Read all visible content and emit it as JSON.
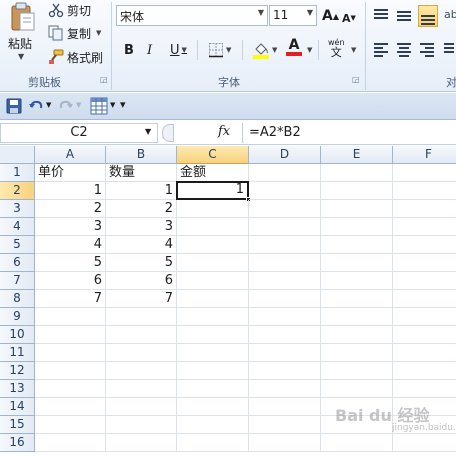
{
  "ribbon": {
    "clipboard": {
      "paste": "粘贴",
      "cut": "剪切",
      "copy": "复制",
      "format_painter": "格式刷",
      "group_label": "剪贴板"
    },
    "font": {
      "font_name": "宋体",
      "font_size": "11",
      "group_label": "字体",
      "bold": "B",
      "italic": "I",
      "underline": "U",
      "grow": "A",
      "shrink": "A",
      "phonetic": "wén",
      "font_color_letter": "A",
      "font_color": "#e02020",
      "fill_color": "#ffff00"
    },
    "alignment": {
      "group_label_partial": "对"
    }
  },
  "formula_bar": {
    "name_box": "C2",
    "fx": "fx",
    "formula": "=A2*B2"
  },
  "grid": {
    "columns": [
      "A",
      "B",
      "C",
      "D",
      "E",
      "F"
    ],
    "rows": [
      "1",
      "2",
      "3",
      "4",
      "5",
      "6",
      "7",
      "8",
      "9",
      "10",
      "11",
      "12",
      "13",
      "14",
      "15",
      "16"
    ],
    "active_col": "C",
    "active_row": "2",
    "cells": [
      {
        "ref": "A1",
        "value": "单价"
      },
      {
        "ref": "B1",
        "value": "数量"
      },
      {
        "ref": "C1",
        "value": "金额"
      },
      {
        "ref": "A2",
        "value": "1"
      },
      {
        "ref": "B2",
        "value": "1"
      },
      {
        "ref": "C2",
        "value": "1"
      },
      {
        "ref": "A3",
        "value": "2"
      },
      {
        "ref": "B3",
        "value": "2"
      },
      {
        "ref": "A4",
        "value": "3"
      },
      {
        "ref": "B4",
        "value": "3"
      },
      {
        "ref": "A5",
        "value": "4"
      },
      {
        "ref": "B5",
        "value": "4"
      },
      {
        "ref": "A6",
        "value": "5"
      },
      {
        "ref": "B6",
        "value": "5"
      },
      {
        "ref": "A7",
        "value": "6"
      },
      {
        "ref": "B7",
        "value": "6"
      },
      {
        "ref": "A8",
        "value": "7"
      },
      {
        "ref": "B8",
        "value": "7"
      }
    ]
  },
  "watermark": {
    "main": "Bai du 经验",
    "sub": "jingyan.baidu.com"
  }
}
